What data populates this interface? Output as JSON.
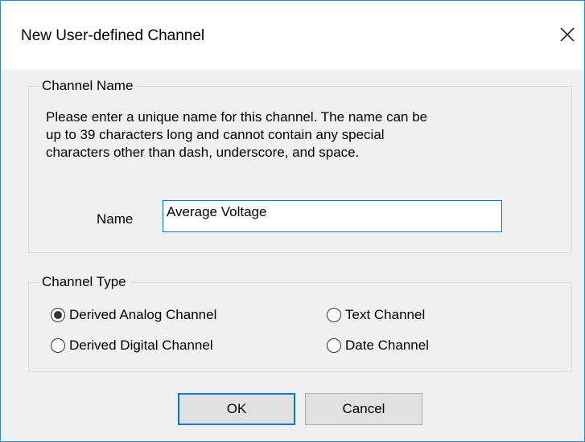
{
  "window": {
    "title": "New User-defined Channel",
    "close_icon": "close-icon"
  },
  "channel_name_group": {
    "title": "Channel Name",
    "description_lines": [
      "Please enter a unique name for this channel. The name can be",
      "up to 39 characters long and cannot contain any special",
      "characters other than dash, underscore, and space."
    ],
    "name_label": "Name",
    "name_value": "Average Voltage"
  },
  "channel_type_group": {
    "title": "Channel Type",
    "options": [
      {
        "label": "Derived Analog Channel",
        "selected": true
      },
      {
        "label": "Derived Digital Channel",
        "selected": false
      },
      {
        "label": "Text Channel",
        "selected": false
      },
      {
        "label": "Date Channel",
        "selected": false
      }
    ]
  },
  "buttons": {
    "ok_label": "OK",
    "cancel_label": "Cancel"
  },
  "colors": {
    "accent": "#0078d7",
    "window_border": "#2b88d8",
    "dialog_bg": "#f0f0f0"
  }
}
